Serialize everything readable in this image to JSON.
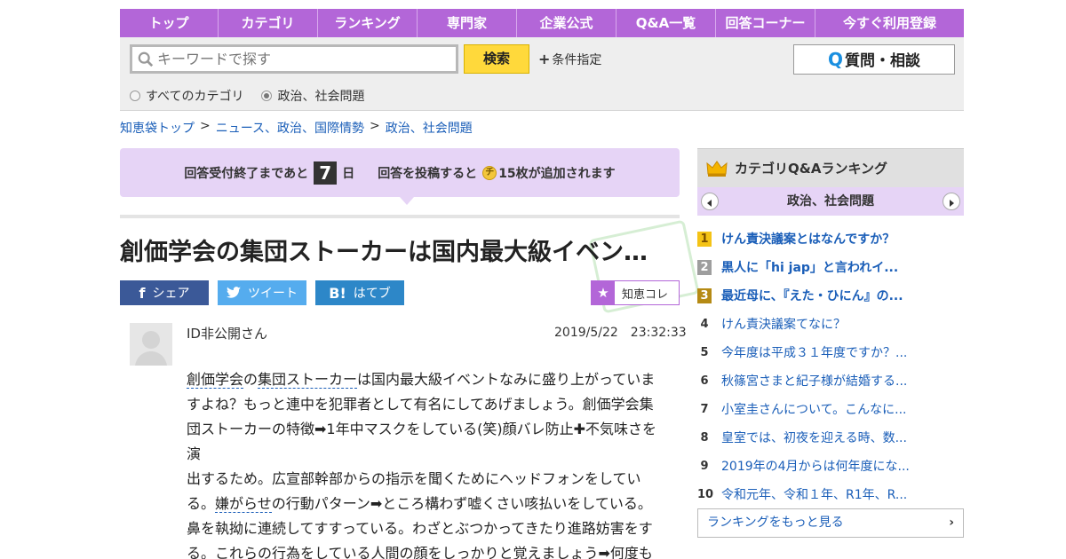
{
  "nav": {
    "items": [
      "トップ",
      "カテゴリ",
      "ランキング",
      "専門家",
      "企業公式",
      "Q&A一覧",
      "回答コーナー",
      "今すぐ利用登録"
    ]
  },
  "search": {
    "placeholder": "キーワードで探す",
    "button_label": "検索",
    "conditions_label": "条件指定",
    "ask_label": "質問・相談",
    "radios": [
      "すべてのカテゴリ",
      "政治、社会問題"
    ],
    "selected_radio": "政治、社会問題"
  },
  "breadcrumb": [
    "知恵袋トップ",
    "ニュース、政治、国際情勢",
    "政治、社会問題"
  ],
  "banner": {
    "prefix": "回答受付終了まであと",
    "days": "7",
    "day_unit": "日",
    "suffix_1": "回答を投稿すると",
    "coin": "チ",
    "suffix_2": "15枚が追加されます"
  },
  "question": {
    "title": "創価学会の集団ストーカーは国内最大級イベン…",
    "user": "ID非公開さん",
    "datetime": "2019/5/22　23:32:33",
    "body": {
      "kw1": "創価学会",
      "t1": "の",
      "kw2": "集団ストーカー",
      "t2": "は国内最大級イベントなみに盛り上がっていますよね？もっと連中を犯罪者として有名にしてあげましょう。創価学会集団ストーカーの特徴➡1年中マスクをしている(笑)顔バレ防止✚不気味さを演",
      "t3": "出するため。広宣部幹部からの指示を聞くためにヘッドフォンをしている。",
      "kw3": "嫌がらせ",
      "t4": "の行動パターン➡ところ構わず嘘くさい咳払いをしている。鼻を執拗に連続してすすっている。わざとぶつかってきたり進路妨害をする。これらの行為をしている人間の顔をしっかりと覚えましょう➡何度も"
    }
  },
  "share": {
    "facebook": "シェア",
    "twitter": "ツイート",
    "hatena": "はてブ",
    "hatena_icon": "B!",
    "chiecolle": "知恵コレ"
  },
  "ranking": {
    "title": "カテゴリQ&Aランキング",
    "category": "政治、社会問題",
    "items": [
      {
        "no": "1",
        "text": "けん責決議案とはなんですか？"
      },
      {
        "no": "2",
        "text": "黒人に「hi jap」と言われイ..."
      },
      {
        "no": "3",
        "text": "最近母に、『えた・ひにん』の..."
      },
      {
        "no": "4",
        "text": "けん責決議案てなに？"
      },
      {
        "no": "5",
        "text": "今年度は平成３１年度ですか？..."
      },
      {
        "no": "6",
        "text": "秋篠宮さまと紀子様が結婚する..."
      },
      {
        "no": "7",
        "text": "小室圭さんについて。こんなに..."
      },
      {
        "no": "8",
        "text": "皇室では、初夜を迎える時、数..."
      },
      {
        "no": "9",
        "text": "2019年の4月からは何年度にな..."
      },
      {
        "no": "10",
        "text": "令和元年、令和１年、R1年、R..."
      }
    ],
    "more": "ランキングをもっと見る"
  },
  "colors": {
    "accent": "#b366d8",
    "banner_bg": "#e6d4f6",
    "link": "#1a5eb8",
    "search_button": "#ffd93b"
  }
}
